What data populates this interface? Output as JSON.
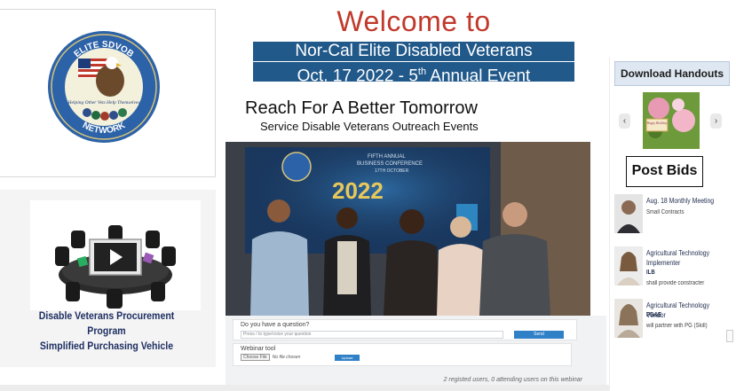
{
  "seal": {
    "top_text": "ELITE SDVOB",
    "motto": "Helping Other Vets Help Themselves",
    "bottom_text": "NETWORK"
  },
  "procurement": {
    "title_line1": "Disable Veterans Procurement Program",
    "title_line2": "Simplified Purchasing Vehicle"
  },
  "header": {
    "welcome": "Welcome to",
    "banner_line1": "Nor-Cal Elite Disabled Veterans",
    "banner_line2_pre": "Oct. 17 2022 - 5",
    "banner_line2_sup": "th",
    "banner_line2_post": " Annual Event",
    "tagline": "Reach For A Better Tomorrow",
    "subtagline": "Service Disable Veterans Outreach Events"
  },
  "photo": {
    "screen_line1": "FIFTH ANNUAL",
    "screen_line2": "BUSINESS CONFERENCE",
    "screen_line3": "17TH OCTOBER",
    "screen_year": "2022"
  },
  "webinar": {
    "question_label": "Do you have a question?",
    "question_placeholder": "Press / to type/voice your question",
    "send_label": "Send",
    "tool_label": "Webinar tool",
    "choose_file_label": "Choose File",
    "file_status": "No file chosen",
    "upload_label": "Upload",
    "users_status": "2 registed users, 0 attending users on this webinar"
  },
  "sidebar": {
    "download_title": "Download Handouts",
    "prev_symbol": "‹",
    "next_symbol": "›",
    "card_text": "Happy Birthday",
    "post_bids_title": "Post Bids",
    "bids": [
      {
        "title": "Aug. 18 Monthly Meeting",
        "tag": "",
        "subtitle": "Small Contracts"
      },
      {
        "title": "Agricultural Technology Implementer",
        "tag": "ILB",
        "subtitle": "shall provide constracter"
      },
      {
        "title": "Agricultural Technology Vendor",
        "tag": "PG&E",
        "subtitle": "will partner with PG (Skill)"
      }
    ]
  },
  "colors": {
    "welcome_red": "#c0392b",
    "banner_blue": "#21598a",
    "procurement_navy": "#1e2f62",
    "button_blue": "#2f80c7"
  }
}
